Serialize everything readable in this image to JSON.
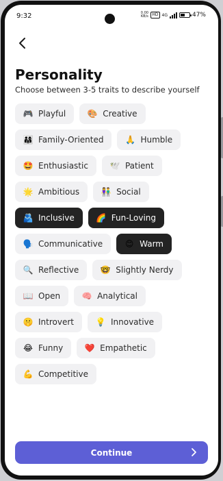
{
  "status_bar": {
    "time": "9:32",
    "network_speed": "0.00 KB/s",
    "network_type": "4G",
    "battery": "47%",
    "battery_level": 0.47
  },
  "header": {
    "back_icon": "chevron-left-icon"
  },
  "title": "Personality",
  "subtitle": "Choose between 3-5 traits to describe yourself",
  "traits": [
    {
      "emoji": "🎮",
      "label": "Playful",
      "selected": false
    },
    {
      "emoji": "🎨",
      "label": "Creative",
      "selected": false
    },
    {
      "emoji": "👨‍👩‍👧",
      "label": "Family-Oriented",
      "selected": false
    },
    {
      "emoji": "🙏",
      "label": "Humble",
      "selected": false
    },
    {
      "emoji": "🤩",
      "label": "Enthusiastic",
      "selected": false
    },
    {
      "emoji": "🕊️",
      "label": "Patient",
      "selected": false
    },
    {
      "emoji": "🌟",
      "label": "Ambitious",
      "selected": false
    },
    {
      "emoji": "👫",
      "label": "Social",
      "selected": false
    },
    {
      "emoji": "🫂",
      "label": "Inclusive",
      "selected": true
    },
    {
      "emoji": "🌈",
      "label": "Fun-Loving",
      "selected": true
    },
    {
      "emoji": "🗣️",
      "label": "Communicative",
      "selected": false
    },
    {
      "emoji": "😊",
      "label": "Warm",
      "selected": true
    },
    {
      "emoji": "🔍",
      "label": "Reflective",
      "selected": false
    },
    {
      "emoji": "🤓",
      "label": "Slightly Nerdy",
      "selected": false
    },
    {
      "emoji": "📖",
      "label": "Open",
      "selected": false
    },
    {
      "emoji": "🧠",
      "label": "Analytical",
      "selected": false
    },
    {
      "emoji": "🤫",
      "label": "Introvert",
      "selected": false
    },
    {
      "emoji": "💡",
      "label": "Innovative",
      "selected": false
    },
    {
      "emoji": "😂",
      "label": "Funny",
      "selected": false
    },
    {
      "emoji": "❤️",
      "label": "Empathetic",
      "selected": false
    },
    {
      "emoji": "💪",
      "label": "Competitive",
      "selected": false
    }
  ],
  "continue_button": {
    "label": "Continue",
    "icon": "chevron-right-icon"
  },
  "colors": {
    "accent": "#5d5fd6",
    "chip_bg": "#f1f1f3",
    "chip_selected_bg": "#232323"
  }
}
